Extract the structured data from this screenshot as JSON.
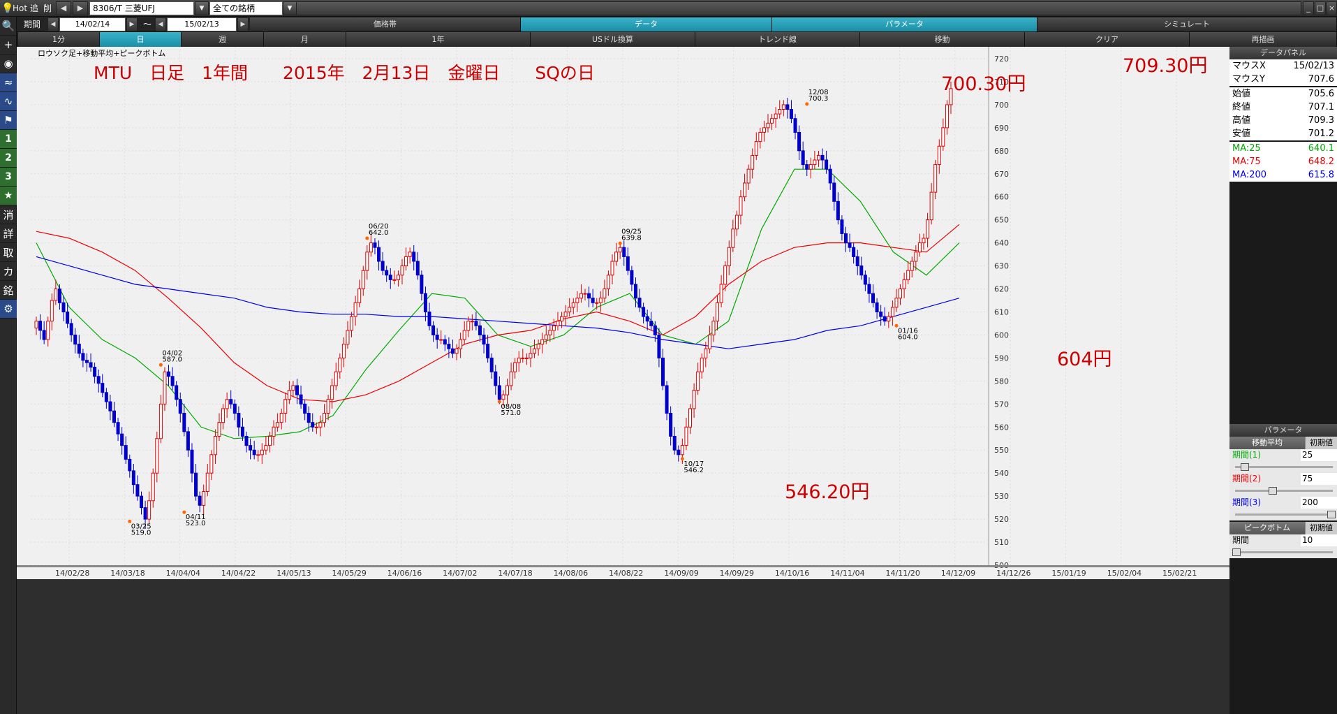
{
  "toolbar": {
    "hot": "Hot",
    "add": "追",
    "del": "削",
    "symbol": "8306/T 三菱UFJ",
    "category": "全ての銘柄"
  },
  "period": {
    "label": "期間",
    "from": "14/02/14",
    "tilde": "～",
    "to": "15/02/13"
  },
  "top_tabs": [
    "価格帯",
    "データ",
    "パラメータ",
    "シミュレート"
  ],
  "view_tabs": [
    "1分",
    "日",
    "週",
    "月",
    "1年",
    "USドル換算",
    "トレンド線",
    "移動",
    "クリア",
    "再描画"
  ],
  "left_tools": [
    "1",
    "2",
    "3",
    "★",
    "消",
    "詳",
    "取",
    "カ",
    "銘"
  ],
  "chart_caption": "ロウソク足+移動平均+ピークボトム",
  "annotation": {
    "title": "MTU　日足　1年間　　2015年　2月13日　金曜日　　SQの日",
    "high1": "700.30円",
    "high2": "709.30円",
    "low1": "546.20円",
    "low2": "604円"
  },
  "data_panel": {
    "title": "データパネル",
    "rows": [
      {
        "k": "マウスX",
        "v": "15/02/13"
      },
      {
        "k": "マウスY",
        "v": "707.6"
      },
      {
        "k": "始値",
        "v": "705.6"
      },
      {
        "k": "終値",
        "v": "707.1"
      },
      {
        "k": "高値",
        "v": "709.3"
      },
      {
        "k": "安値",
        "v": "701.2"
      }
    ],
    "ma": [
      {
        "k": "MA:25",
        "v": "640.1",
        "color": "#00aa00"
      },
      {
        "k": "MA:75",
        "v": "648.2",
        "color": "#ee0000"
      },
      {
        "k": "MA:200",
        "v": "615.8",
        "color": "#0000ee"
      }
    ]
  },
  "params": {
    "title": "パラメータ",
    "ma_title": "移動平均",
    "init": "初期値",
    "p1": "期間(1)",
    "v1": "25",
    "p2": "期間(2)",
    "v2": "75",
    "p3": "期間(3)",
    "v3": "200",
    "pb_title": "ピークボトム",
    "pb_label": "期間",
    "pb_value": "10"
  },
  "chart_data": {
    "type": "candlestick",
    "symbol": "8306/T 三菱UFJ",
    "ylim": [
      500,
      720
    ],
    "yticks": [
      500,
      510,
      520,
      530,
      540,
      550,
      560,
      570,
      580,
      590,
      600,
      610,
      620,
      630,
      640,
      650,
      660,
      670,
      680,
      690,
      700,
      710,
      720
    ],
    "xticks": [
      "14/02/28",
      "14/03/18",
      "14/04/04",
      "14/04/22",
      "14/05/13",
      "14/05/29",
      "14/06/16",
      "14/07/02",
      "14/07/18",
      "14/08/06",
      "14/08/22",
      "14/09/09",
      "14/09/29",
      "14/10/16",
      "14/11/04",
      "14/11/20",
      "14/12/09",
      "14/12/26",
      "15/01/19",
      "15/02/04",
      "15/02/21"
    ],
    "peaks": [
      {
        "date": "04/02",
        "value": "587.0",
        "v": 587,
        "type": "high",
        "i": 32
      },
      {
        "date": "06/20",
        "value": "642.0",
        "v": 642,
        "type": "high",
        "i": 85
      },
      {
        "date": "09/25",
        "value": "639.8",
        "v": 639.8,
        "type": "high",
        "i": 150
      },
      {
        "date": "12/08",
        "value": "700.3",
        "v": 700.3,
        "type": "high",
        "i": 198
      }
    ],
    "bottoms": [
      {
        "date": "03/25",
        "value": "519.0",
        "v": 519,
        "type": "low",
        "i": 24
      },
      {
        "date": "04/11",
        "value": "523.0",
        "v": 523,
        "type": "low",
        "i": 38
      },
      {
        "date": "08/08",
        "value": "571.0",
        "v": 571,
        "type": "low",
        "i": 119
      },
      {
        "date": "10/17",
        "value": "546.2",
        "v": 546.2,
        "type": "low",
        "i": 166
      },
      {
        "date": "01/16",
        "value": "604.0",
        "v": 604,
        "type": "low",
        "i": 221
      }
    ],
    "closes": [
      606,
      602,
      598,
      606,
      615,
      620,
      614,
      610,
      605,
      600,
      596,
      592,
      589,
      588,
      586,
      582,
      579,
      575,
      571,
      567,
      562,
      557,
      552,
      546,
      541,
      535,
      530,
      525,
      520,
      528,
      540,
      555,
      570,
      584,
      582,
      578,
      572,
      566,
      558,
      550,
      540,
      530,
      526,
      532,
      540,
      548,
      556,
      562,
      568,
      572,
      570,
      566,
      560,
      556,
      552,
      550,
      548,
      548,
      550,
      552,
      556,
      560,
      562,
      566,
      572,
      576,
      578,
      574,
      570,
      566,
      562,
      560,
      560,
      562,
      566,
      572,
      578,
      584,
      590,
      596,
      602,
      608,
      614,
      620,
      628,
      636,
      640,
      638,
      632,
      628,
      626,
      624,
      624,
      626,
      630,
      634,
      636,
      632,
      626,
      618,
      610,
      604,
      600,
      598,
      598,
      596,
      594,
      592,
      594,
      598,
      602,
      606,
      606,
      604,
      600,
      596,
      590,
      584,
      578,
      572,
      574,
      578,
      584,
      588,
      590,
      590,
      590,
      592,
      594,
      596,
      598,
      600,
      602,
      604,
      606,
      608,
      610,
      612,
      614,
      616,
      618,
      618,
      616,
      614,
      614,
      616,
      620,
      626,
      632,
      636,
      638,
      634,
      628,
      622,
      616,
      612,
      608,
      606,
      604,
      600,
      590,
      578,
      566,
      556,
      550,
      548,
      552,
      560,
      568,
      576,
      584,
      590,
      594,
      600,
      606,
      614,
      622,
      630,
      638,
      646,
      652,
      660,
      666,
      672,
      678,
      684,
      688,
      690,
      692,
      694,
      696,
      698,
      700,
      698,
      694,
      688,
      680,
      674,
      672,
      674,
      676,
      678,
      676,
      672,
      666,
      658,
      650,
      644,
      640,
      638,
      634,
      630,
      626,
      622,
      618,
      614,
      610,
      608,
      606,
      608,
      612,
      616,
      620,
      624,
      628,
      632,
      636,
      640,
      642,
      650,
      662,
      674,
      682,
      690,
      700,
      707
    ],
    "ma_lines": [
      {
        "name": "MA:25",
        "color": "#00aa00",
        "values": [
          640,
          612,
          598,
          590,
          578,
          560,
          555,
          556,
          558,
          565,
          585,
          602,
          618,
          616,
          600,
          595,
          600,
          612,
          618,
          600,
          596,
          606,
          646,
          672,
          672,
          658,
          636,
          626,
          640
        ]
      },
      {
        "name": "MA:75",
        "color": "#ee0000",
        "values": [
          645,
          642,
          636,
          628,
          616,
          603,
          588,
          578,
          572,
          571,
          574,
          580,
          588,
          596,
          600,
          602,
          607,
          610,
          606,
          600,
          608,
          622,
          632,
          638,
          640,
          640,
          638,
          636,
          648
        ]
      },
      {
        "name": "MA:200",
        "color": "#0000ee",
        "values": [
          634,
          630,
          626,
          622,
          620,
          618,
          616,
          612,
          610,
          609,
          609,
          608,
          608,
          607,
          606,
          605,
          604,
          603,
          601,
          598,
          596,
          594,
          596,
          598,
          602,
          604,
          608,
          612,
          616
        ]
      }
    ]
  }
}
